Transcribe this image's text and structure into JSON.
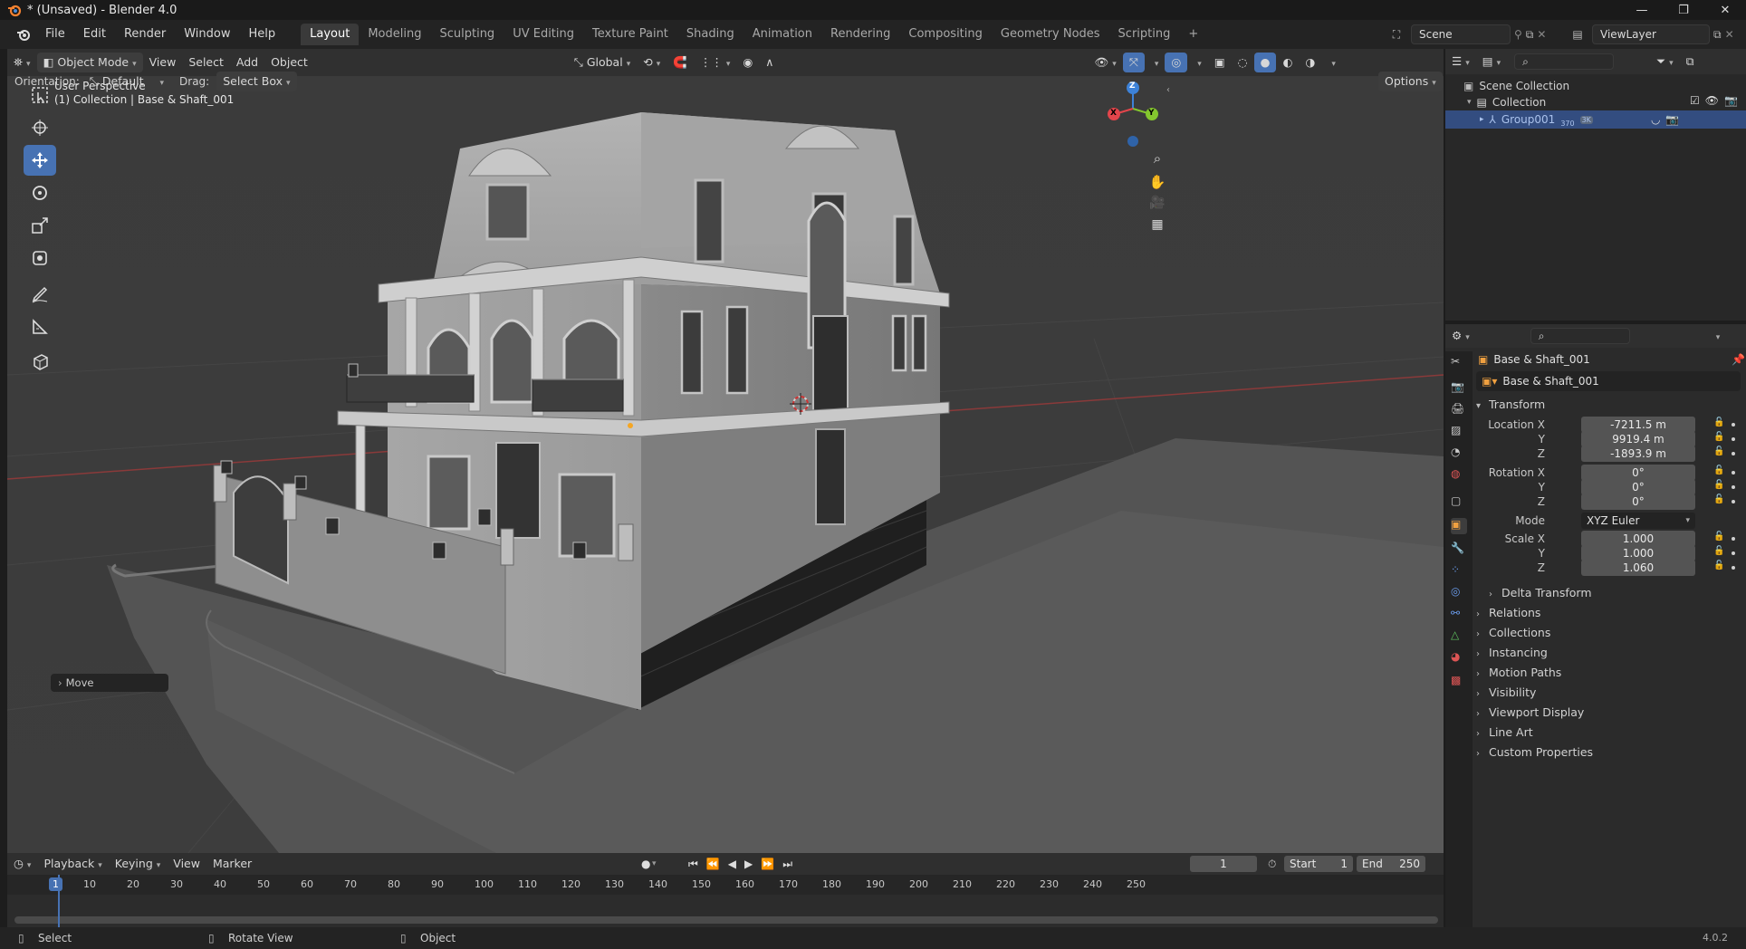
{
  "window": {
    "title": "* (Unsaved) - Blender 4.0"
  },
  "menu": [
    "File",
    "Edit",
    "Render",
    "Window",
    "Help"
  ],
  "workspaces": [
    {
      "label": "Layout",
      "active": true
    },
    {
      "label": "Modeling"
    },
    {
      "label": "Sculpting"
    },
    {
      "label": "UV Editing"
    },
    {
      "label": "Texture Paint"
    },
    {
      "label": "Shading"
    },
    {
      "label": "Animation"
    },
    {
      "label": "Rendering"
    },
    {
      "label": "Compositing"
    },
    {
      "label": "Geometry Nodes"
    },
    {
      "label": "Scripting"
    }
  ],
  "add_workspace": "+",
  "scene": {
    "name": "Scene",
    "view_layer": "ViewLayer"
  },
  "viewport_header": {
    "mode": "Object Mode",
    "menus": [
      "View",
      "Select",
      "Add",
      "Object"
    ],
    "transform_orientation": "Global",
    "options_label": "Options"
  },
  "tool_settings": {
    "orientation_label": "Orientation:",
    "orientation_value": "Default",
    "drag_label": "Drag:",
    "drag_value": "Select Box"
  },
  "viewport": {
    "view_name": "User Perspective",
    "collection_info": "(1) Collection | Base & Shaft_001",
    "gizmo_axes": [
      "X",
      "Y",
      "Z"
    ],
    "last_operator": "Move"
  },
  "outliner": {
    "root": "Scene Collection",
    "collection": "Collection",
    "child": "Group001",
    "child_badge_1": "370",
    "child_badge_2": "3K"
  },
  "properties": {
    "object_name": "Base & Shaft_001",
    "object_data_name": "Base & Shaft_001",
    "transform_label": "Transform",
    "location": {
      "label": "Location X",
      "x": "-7211.5 m",
      "y": "9919.4 m",
      "z": "-1893.9 m"
    },
    "rotation": {
      "label": "Rotation X",
      "x": "0°",
      "y": "0°",
      "z": "0°"
    },
    "mode_label": "Mode",
    "mode_value": "XYZ Euler",
    "scale": {
      "label": "Scale X",
      "x": "1.000",
      "y": "1.000",
      "z": "1.060"
    },
    "axis_labels": {
      "y": "Y",
      "z": "Z"
    },
    "delta_transform": "Delta Transform",
    "sections": [
      "Relations",
      "Collections",
      "Instancing",
      "Motion Paths",
      "Visibility",
      "Viewport Display",
      "Line Art",
      "Custom Properties"
    ]
  },
  "timeline": {
    "menus": [
      "Playback",
      "Keying",
      "View",
      "Marker"
    ],
    "current_frame": "1",
    "start_label": "Start",
    "start": "1",
    "end_label": "End",
    "end": "250",
    "ruler_ticks": [
      "1",
      "10",
      "20",
      "30",
      "40",
      "50",
      "60",
      "70",
      "80",
      "90",
      "100",
      "110",
      "120",
      "130",
      "140",
      "150",
      "160",
      "170",
      "180",
      "190",
      "200",
      "210",
      "220",
      "230",
      "240",
      "250"
    ]
  },
  "statusbar": {
    "select": "Select",
    "rotate_view": "Rotate View",
    "object": "Object",
    "version": "4.0.2"
  },
  "colors": {
    "accent": "#4772b3",
    "axis_x": "#e3454b",
    "axis_y": "#84c62e",
    "axis_z": "#3d82d8",
    "viewport_bg": "#3c3c3c",
    "selection_orange": "#f5a623"
  }
}
